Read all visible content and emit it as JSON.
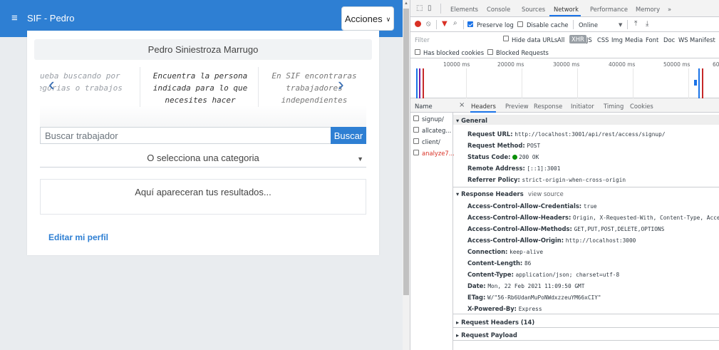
{
  "app": {
    "brand": "SIF - Pedro",
    "actions_label": "Acciones",
    "profile_name": "Pedro Siniestroza Marrugo",
    "carousel": {
      "slide_1": "rueba buscando por\ntegorias o trabajos",
      "slide_2": "Encuentra la persona\nindicada para lo que\nnecesites hacer",
      "slide_3": "En SIF encontraras\ntrabajadores\nindependientes"
    },
    "search": {
      "placeholder": "Buscar trabajador",
      "button": "Buscar"
    },
    "category_select": "O selecciona una categoria",
    "results_placeholder": "Aquí apareceran tus resultados...",
    "edit_profile": "Editar mi perfil"
  },
  "devtools": {
    "tabs": [
      "Elements",
      "Console",
      "Sources",
      "Network",
      "Performance",
      "Memory",
      "»"
    ],
    "active_tab": "Network",
    "toolbar": {
      "preserve_log": "Preserve log",
      "disable_cache": "Disable cache",
      "throttle": "Online"
    },
    "filter": {
      "placeholder": "Filter",
      "hide_data_urls": "Hide data URLs",
      "types": [
        "All",
        "XHR",
        "JS",
        "CSS",
        "Img",
        "Media",
        "Font",
        "Doc",
        "WS",
        "Manifest"
      ]
    },
    "blocked": {
      "has_blocked_cookies": "Has blocked cookies",
      "blocked_requests": "Blocked Requests"
    },
    "timeline_ticks": [
      "10000 ms",
      "20000 ms",
      "30000 ms",
      "40000 ms",
      "50000 ms",
      "60"
    ],
    "name_header": "Name",
    "requests": [
      "signup/",
      "allcateg...",
      "client/",
      "analyze7..."
    ],
    "detail_tabs": [
      "Headers",
      "Preview",
      "Response",
      "Initiator",
      "Timing",
      "Cookies"
    ],
    "close_glyph": "×",
    "general": {
      "title": "General",
      "request_url_label": "Request URL:",
      "request_url": "http://localhost:3001/api/rest/access/signup/",
      "request_method_label": "Request Method:",
      "request_method": "POST",
      "status_code_label": "Status Code:",
      "status_code": "200 OK",
      "remote_address_label": "Remote Address:",
      "remote_address": "[::1]:3001",
      "referrer_policy_label": "Referrer Policy:",
      "referrer_policy": "strict-origin-when-cross-origin"
    },
    "response_headers": {
      "title": "Response Headers",
      "view_source": "view source",
      "items": [
        {
          "k": "Access-Control-Allow-Credentials:",
          "v": "true"
        },
        {
          "k": "Access-Control-Allow-Headers:",
          "v": "Origin, X-Requested-With, Content-Type, Accept"
        },
        {
          "k": "Access-Control-Allow-Methods:",
          "v": "GET,PUT,POST,DELETE,OPTIONS"
        },
        {
          "k": "Access-Control-Allow-Origin:",
          "v": "http://localhost:3000"
        },
        {
          "k": "Connection:",
          "v": "keep-alive"
        },
        {
          "k": "Content-Length:",
          "v": "86"
        },
        {
          "k": "Content-Type:",
          "v": "application/json; charset=utf-8"
        },
        {
          "k": "Date:",
          "v": "Mon, 22 Feb 2021 11:09:50 GMT"
        },
        {
          "k": "ETag:",
          "v": "W/\"56-Rb6UdanMuPoNWdxzzeuYM66xCIY\""
        },
        {
          "k": "X-Powered-By:",
          "v": "Express"
        }
      ]
    },
    "request_headers": "Request Headers (14)",
    "request_payload": "Request Payload"
  }
}
